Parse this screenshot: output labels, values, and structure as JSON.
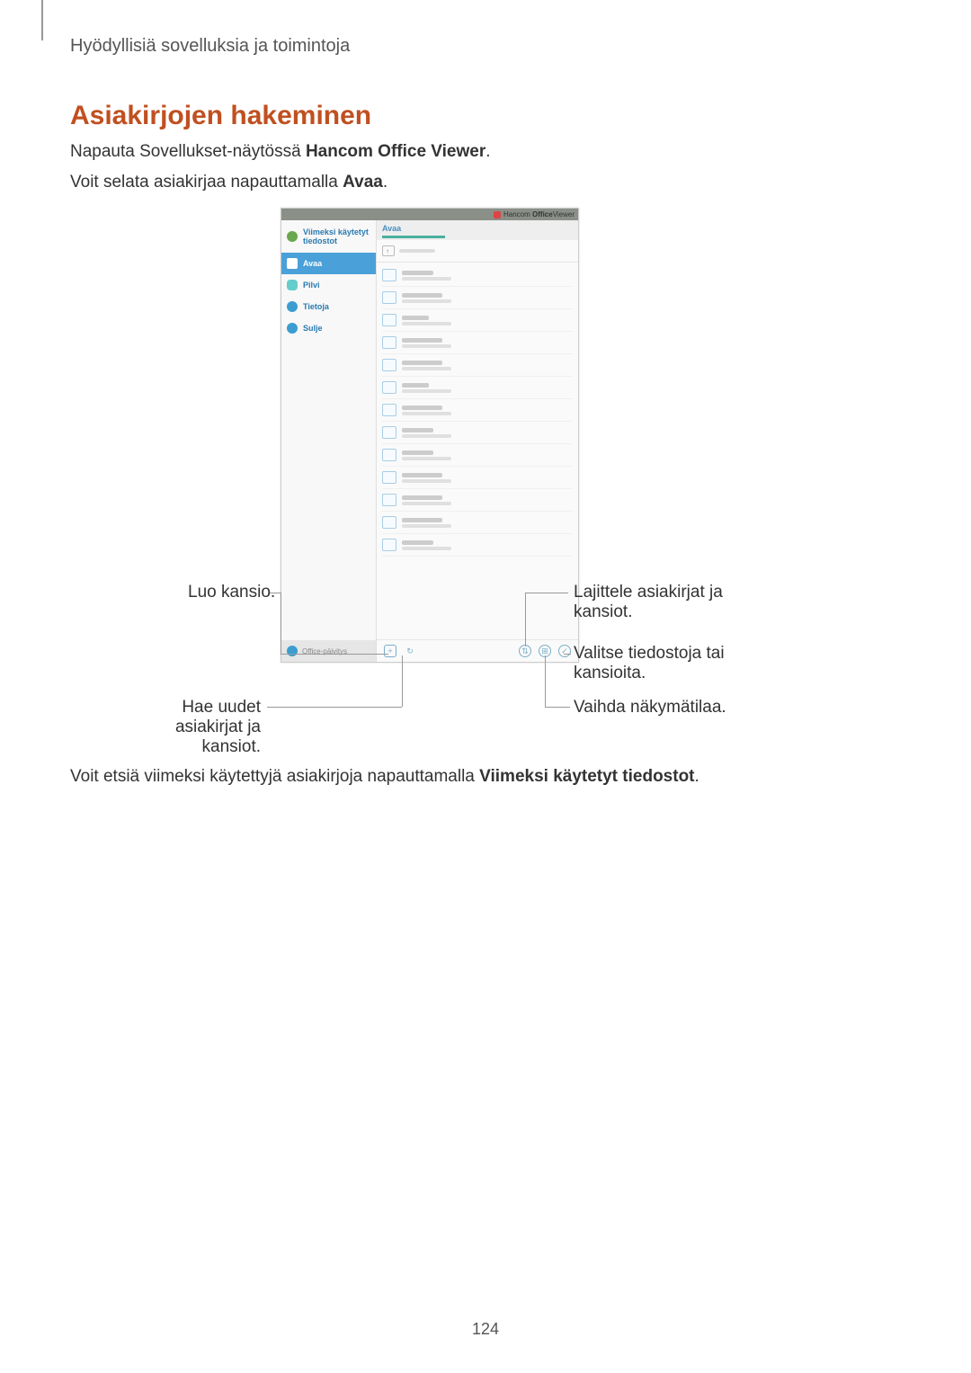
{
  "header": "Hyödyllisiä sovelluksia ja toimintoja",
  "title": "Asiakirjojen hakeminen",
  "para1_prefix": "Napauta Sovellukset-näytössä ",
  "para1_bold": "Hancom Office Viewer",
  "para1_suffix": ".",
  "para2_prefix": "Voit selata asiakirjaa napauttamalla ",
  "para2_bold": "Avaa",
  "para2_suffix": ".",
  "app": {
    "brand_prefix": "Hancom ",
    "brand_bold": "Office",
    "brand_suffix": "Viewer",
    "sidebar": {
      "recent": "Viimeksi käytetyt tiedostot",
      "open": "Avaa",
      "cloud": "Pilvi",
      "info": "Tietoja",
      "close": "Sulje",
      "update": "Office-päivitys"
    },
    "main_title": "Avaa",
    "toolbar": {
      "add": "+",
      "refresh": "↻",
      "sort": "⇅",
      "grid": "⊞",
      "select": "✓"
    }
  },
  "callouts": {
    "create_folder": "Luo kansio.",
    "fetch1": "Hae uudet asiakirjat ja",
    "fetch2": "kansiot.",
    "sort1": "Lajittele asiakirjat ja",
    "sort2": "kansiot.",
    "select1": "Valitse tiedostoja tai",
    "select2": "kansioita.",
    "view": "Vaihda näkymätilaa."
  },
  "para3_prefix": "Voit etsiä viimeksi käytettyjä asiakirjoja napauttamalla ",
  "para3_bold": "Viimeksi käytetyt tiedostot",
  "para3_suffix": ".",
  "page_number": "124"
}
